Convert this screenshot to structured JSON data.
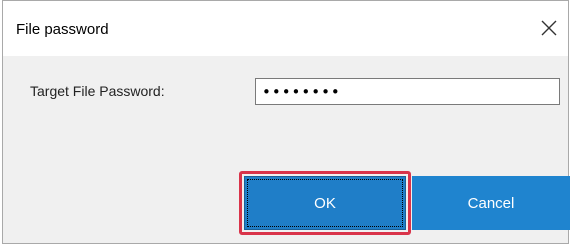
{
  "dialog": {
    "title": "File password",
    "close_icon": "close-icon"
  },
  "form": {
    "password_label": "Target File Password:",
    "password_value": "••••••••"
  },
  "buttons": {
    "ok_label": "OK",
    "cancel_label": "Cancel"
  },
  "colors": {
    "button_blue": "#1f7ec8",
    "highlight_red": "#d9344a"
  }
}
